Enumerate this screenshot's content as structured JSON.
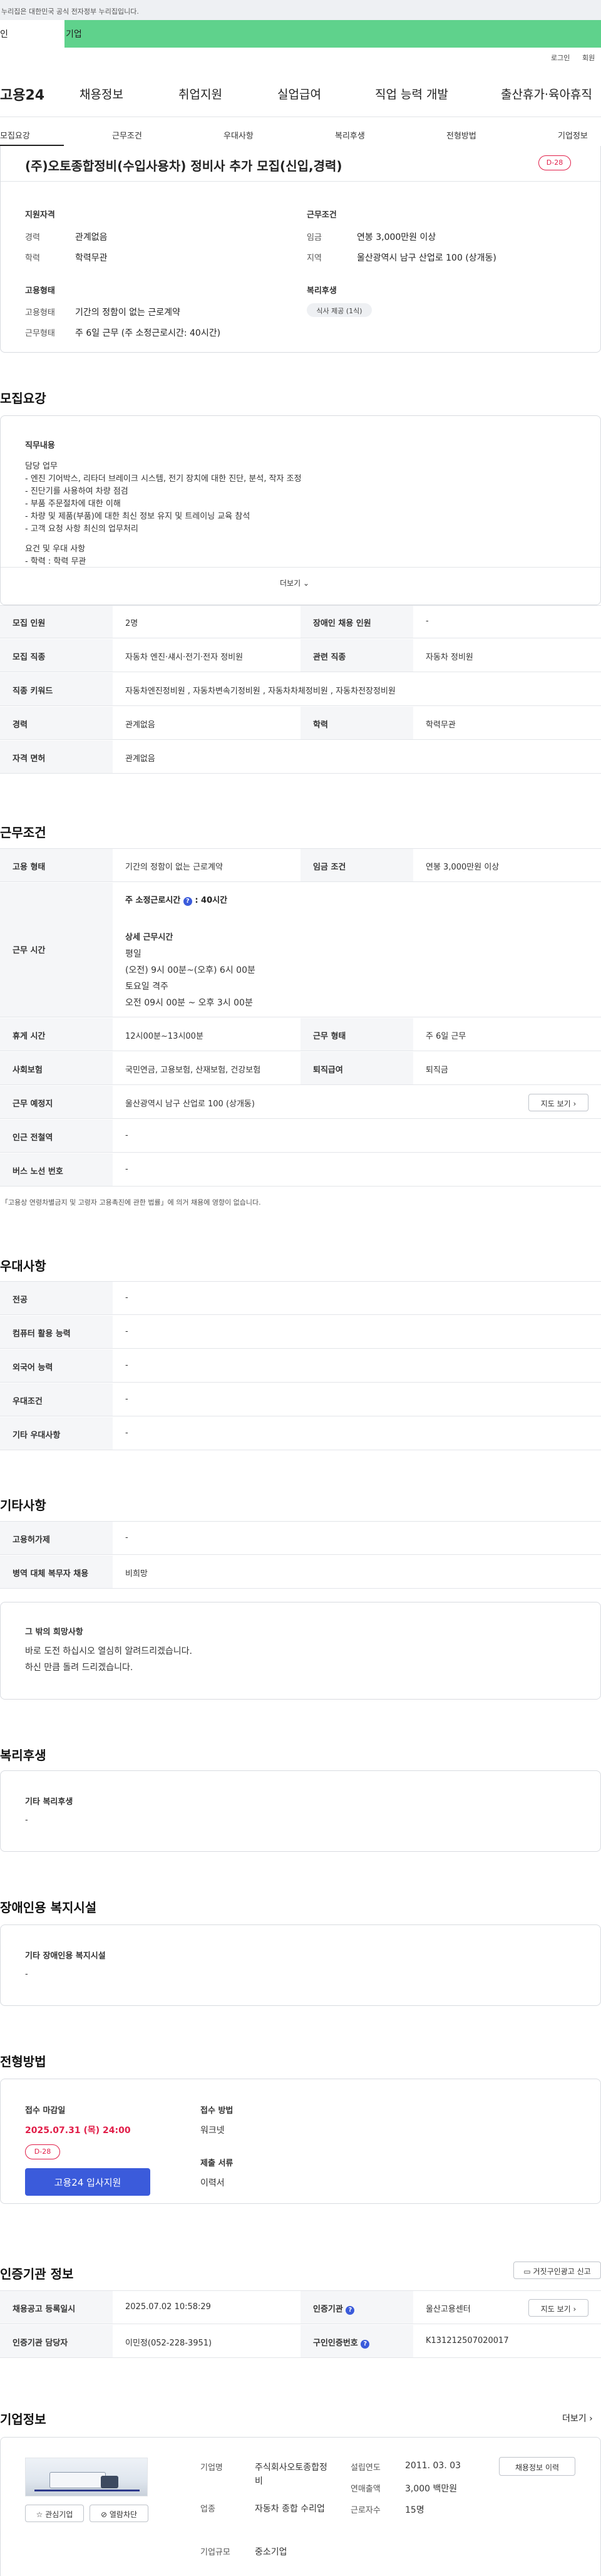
{
  "topbar": {
    "notice": "누리집은 대한민국 공식 전자정부 누리집입니다."
  },
  "tabs": {
    "personal": "인",
    "company": "기업"
  },
  "util": {
    "login": "로그인",
    "signup": "회원"
  },
  "gnb": {
    "logo": "고용24",
    "items": [
      "채용정보",
      "취업지원",
      "실업급여",
      "직업 능력 개발",
      "출산휴가·육아휴직"
    ]
  },
  "subnav": [
    "모집요강",
    "근무조건",
    "우대사항",
    "복리후생",
    "전형방법",
    "기업정보"
  ],
  "job": {
    "title": "(주)오토종합정비(수입사용차) 정비사 추가 모집(신입,경력)",
    "dday": "D-28",
    "qual_h": "지원자격",
    "cond_h": "근무조건",
    "type_h": "고용형태",
    "welfare_h": "복리후생",
    "career_l": "경력",
    "career_v": "관계없음",
    "edu_l": "학력",
    "edu_v": "학력무관",
    "wage_l": "임금",
    "wage_v": "연봉 3,000만원 이상",
    "region_l": "지역",
    "region_v": "울산광역시 남구 산업로 100 (상개동)",
    "emp_l": "고용형태",
    "emp_v": "기간의 정함이 없는 근로계약",
    "work_l": "근무형태",
    "work_v": "주 6일 근무 (주 소정근로시간: 40시간)",
    "welfare_chip": "식사 제공 (1식)"
  },
  "recruit": {
    "h": "모집요강",
    "duty_h": "직무내용",
    "lines": [
      "담당 업무",
      "- 엔진 기어박스, 리타더 브레이크 시스템, 전기 장치에 대한 진단, 분석, 작자 조정",
      "- 진단기를 사용하여 차량 점검",
      "- 부품 주문절차에 대한 이해",
      "- 차량 및 제품(부품)에 대한 최신 정보 유지 및 트레이닝 교육 참석",
      "- 고객 요청 사항 최신의 업무처리",
      "",
      "요건 및 우대 사항",
      "- 학력 : 학력 무관"
    ],
    "more": "더보기",
    "rows": [
      {
        "k1": "모집 인원",
        "v1": "2명",
        "k2": "장애인 채용 인원",
        "v2": "-"
      },
      {
        "k1": "모집 직종",
        "v1": "자동차 엔진·섀시·전기·전자 정비원",
        "k2": "관련 직종",
        "v2": "자동차 정비원"
      },
      {
        "k1": "직종 키워드",
        "v1": "자동차엔진정비원 , 자동차변속기정비원 , 자동차차체정비원 , 자동차전장정비원"
      },
      {
        "k1": "경력",
        "v1": "관계없음",
        "k2": "학력",
        "v2": "학력무관"
      },
      {
        "k1": "자격 면허",
        "v1": "관계없음"
      }
    ]
  },
  "work": {
    "h": "근무조건",
    "emp_k": "고용 형태",
    "emp_v": "기간의 정함이 없는 근로계약",
    "wage_k": "임금 조건",
    "wage_v": "연봉 3,000만원 이상",
    "time_k": "근무 시간",
    "time_main": "주 소정근로시간",
    "time_main_v": ": 40시간",
    "detail_h": "상세 근무시간",
    "detail": [
      "평일",
      "(오전) 9시 00분~(오후) 6시 00분",
      "토요일 격주",
      "오전 09시 00분 ~ 오후 3시 00분"
    ],
    "rest_k": "휴게 시간",
    "rest_v": "12시00분~13시00분",
    "form_k": "근무 형태",
    "form_v": "주 6일 근무",
    "ins_k": "사회보험",
    "ins_v": "국민연금, 고용보험, 산재보험, 건강보험",
    "ret_k": "퇴직급여",
    "ret_v": "퇴직금",
    "loc_k": "근무 예정지",
    "loc_v": "울산광역시 남구 산업로 100 (상개동)",
    "map_btn": "지도 보기",
    "sub_k": "인근 전철역",
    "sub_v": "-",
    "bus_k": "버스 노선 번호",
    "bus_v": "-",
    "note": "「고용상 연령차별금지 및 고령자 고용촉진에 관한 법률」에 의거 채용에 영향이 없습니다."
  },
  "prefer": {
    "h": "우대사항",
    "rows": [
      {
        "k": "전공",
        "v": "-"
      },
      {
        "k": "컴퓨터 활용 능력",
        "v": "-"
      },
      {
        "k": "외국어 능력",
        "v": "-"
      },
      {
        "k": "우대조건",
        "v": "-"
      },
      {
        "k": "기타 우대사항",
        "v": "-"
      }
    ]
  },
  "etc": {
    "h": "기타사항",
    "rows": [
      {
        "k": "고용허가제",
        "v": "-"
      },
      {
        "k": "병역 대체 복무자 채용",
        "v": "비희망"
      }
    ],
    "box_h": "그 밖의 희망사항",
    "box_lines": [
      "바로 도전 하십시오 열심히 알려드리겠습니다.",
      "하신 만큼 돌려 드리겠습니다."
    ]
  },
  "benefit": {
    "h": "복리후생",
    "box_h": "기타 복리후생",
    "box_v": "-"
  },
  "disab": {
    "h": "장애인용 복지시설",
    "box_h": "기타 장애인용 복지시설",
    "box_v": "-"
  },
  "select": {
    "h": "전형방법",
    "deadline_h": "접수 마감일",
    "deadline_v": "2025.07.31 (목) 24:00",
    "dday": "D-28",
    "apply_btn": "고용24 입사지원",
    "method_h": "접수 방법",
    "method_v": "워크넷",
    "docs_h": "제출 서류",
    "docs_v": "이력서"
  },
  "cert": {
    "h": "인증기관 정보",
    "report_btn": "거짓구인광고 신고",
    "r1k1": "채용공고 등록일시",
    "r1v1": "2025.07.02 10:58:29",
    "r1k2": "인증기관",
    "r1v2": "울산고용센터",
    "map_btn": "지도 보기",
    "r2k1": "인증기관 담당자",
    "r2v1": "이민정(052-228-3951)",
    "r2k2": "구인인증번호",
    "r2v2": "K131212507020017"
  },
  "company": {
    "h": "기업정보",
    "more": "더보기",
    "fav": "관심기업",
    "block": "열람차단",
    "name_k": "기업명",
    "name_v": "주식회사오토종합정비",
    "ind_k": "업종",
    "ind_v": "자동차 종합 수리업",
    "size_k": "기업규모",
    "size_v": "중소기업",
    "est_k": "설립연도",
    "est_v": "2011. 03. 03",
    "sales_k": "연매출액",
    "sales_v": "3,000 백만원",
    "emp_k": "근로자수",
    "emp_v": "15명",
    "jobs_btn": "채용정보 이력"
  }
}
